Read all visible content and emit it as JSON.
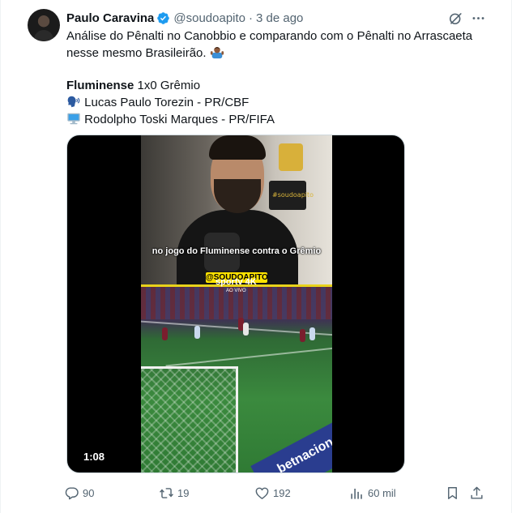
{
  "tweet": {
    "author_name": "Paulo Caravina",
    "handle": "@soudoapito",
    "separator": "·",
    "time": "3 de ago",
    "lines": [
      "Análise do Pênalti no Canobbio e comparando com o Pênalti no Arrascaeta",
      "nesse mesmo Brasileirão."
    ],
    "match_team_home": "Fluminense",
    "match_score": " 1x0 Grêmio",
    "referee": "Lucas Paulo Torezin - PR/CBF",
    "var": "Rodolpho Toski Marques - PR/FIFA"
  },
  "media": {
    "caption": "no jogo do Fluminense contra o Grêmio",
    "tag": "@SOUDOAPITO",
    "box_text": "#soudoapito",
    "broadcaster": "sportv 4K",
    "broadcaster_sub": "AO VIVO",
    "ad_text": "betnacional",
    "duration": "1:08"
  },
  "actions": {
    "replies": "90",
    "reposts": "19",
    "likes": "192",
    "views": "60 mil"
  },
  "icons": {
    "verified": "verified-badge-icon",
    "grok": "grok-icon",
    "more": "more-icon",
    "reply": "reply-icon",
    "repost": "repost-icon",
    "like": "like-icon",
    "views": "views-icon",
    "bookmark": "bookmark-icon",
    "share": "share-icon"
  },
  "colors": {
    "text": "#0f1419",
    "secondary": "#536471",
    "verified": "#1d9bf0"
  }
}
